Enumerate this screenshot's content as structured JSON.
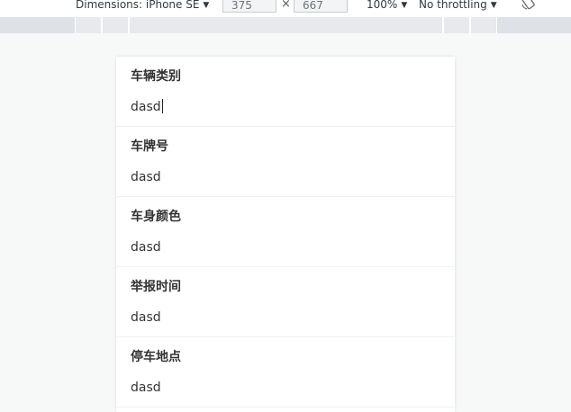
{
  "toolbar": {
    "dimensions_label": "Dimensions: iPhone SE",
    "width_value": "375",
    "height_value": "667",
    "times_sign": "×",
    "zoom_label": "100%",
    "throttling_label": "No throttling",
    "rotate_icon": "rotate-device-icon"
  },
  "form": {
    "fields": [
      {
        "label": "车辆类别",
        "value": "dasd"
      },
      {
        "label": "车牌号",
        "value": "dasd"
      },
      {
        "label": "车身颜色",
        "value": "dasd"
      },
      {
        "label": "举报时间",
        "value": "dasd"
      },
      {
        "label": "停车地点",
        "value": "dasd"
      }
    ]
  },
  "colors": {
    "page_background": "#f7f8f8",
    "ruler": "#dee1e6",
    "text": "#333333",
    "divider": "#f0f1f2"
  }
}
